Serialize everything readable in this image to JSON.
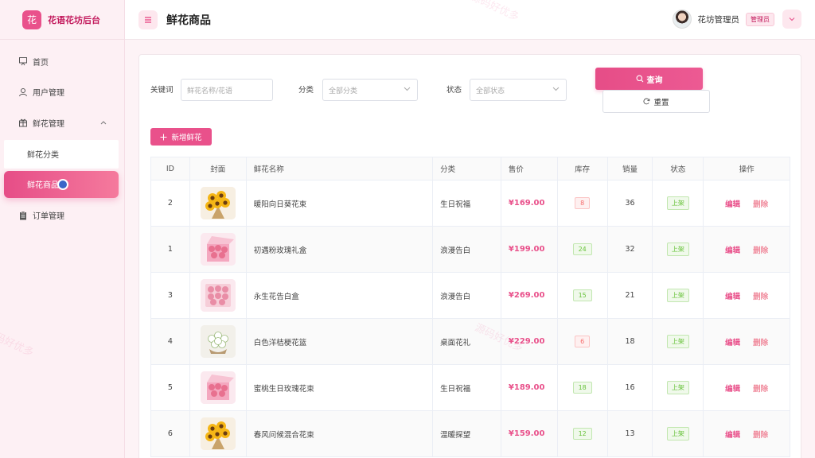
{
  "brand": {
    "logo": "花",
    "name": "花语花坊后台"
  },
  "sidebar": {
    "items": [
      {
        "label": "首页",
        "icon": "easel-icon"
      },
      {
        "label": "用户管理",
        "icon": "user-icon"
      },
      {
        "label": "鲜花管理",
        "icon": "gift-icon",
        "expanded": true,
        "children": [
          {
            "label": "鲜花分类"
          },
          {
            "label": "鲜花商品",
            "active": true
          }
        ]
      },
      {
        "label": "订单管理",
        "icon": "clipboard-icon"
      }
    ]
  },
  "header": {
    "title": "鲜花商品",
    "user_name": "花坊管理员",
    "role": "管理员"
  },
  "filters": {
    "keyword_label": "关键词",
    "keyword_placeholder": "鲜花名称/花语",
    "category_label": "分类",
    "category_value": "全部分类",
    "status_label": "状态",
    "status_value": "全部状态",
    "query_label": "查询",
    "reset_label": "重置"
  },
  "actions": {
    "add_label": "新增鲜花"
  },
  "table": {
    "columns": [
      "ID",
      "封面",
      "鲜花名称",
      "分类",
      "售价",
      "库存",
      "销量",
      "状态",
      "操作"
    ],
    "edit_label": "编辑",
    "delete_label": "删除",
    "rows": [
      {
        "id": "2",
        "name": "暖阳向日葵花束",
        "category": "生日祝福",
        "price": "¥169.00",
        "stock": "8",
        "stock_level": "low",
        "sales": "36",
        "status": "上架",
        "cover": "sunflower"
      },
      {
        "id": "1",
        "name": "初遇粉玫瑰礼盒",
        "category": "浪漫告白",
        "price": "¥199.00",
        "stock": "24",
        "stock_level": "ok",
        "sales": "32",
        "status": "上架",
        "cover": "pink-box"
      },
      {
        "id": "3",
        "name": "永生花告白盒",
        "category": "浪漫告白",
        "price": "¥269.00",
        "stock": "15",
        "stock_level": "ok",
        "sales": "21",
        "status": "上架",
        "cover": "preserved-box"
      },
      {
        "id": "4",
        "name": "白色洋桔梗花篮",
        "category": "桌面花礼",
        "price": "¥229.00",
        "stock": "6",
        "stock_level": "low",
        "sales": "18",
        "status": "上架",
        "cover": "white-basket"
      },
      {
        "id": "5",
        "name": "蜜桃生日玫瑰花束",
        "category": "生日祝福",
        "price": "¥189.00",
        "stock": "18",
        "stock_level": "ok",
        "sales": "16",
        "status": "上架",
        "cover": "pink-box"
      },
      {
        "id": "6",
        "name": "春风问候混合花束",
        "category": "温暖探望",
        "price": "¥159.00",
        "stock": "12",
        "stock_level": "ok",
        "sales": "13",
        "status": "上架",
        "cover": "sunflower"
      }
    ]
  },
  "watermark": "源码好优多",
  "colors": {
    "accent": "#e9518b",
    "brand_text": "#c2185b",
    "ok": "#67c23a",
    "low": "#f56c6c"
  }
}
